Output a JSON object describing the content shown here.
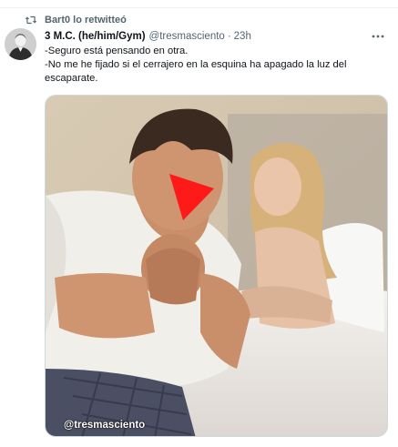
{
  "social_context": {
    "label": "Bart0 lo retwitteó",
    "icon": "retweet-icon"
  },
  "tweet": {
    "author": {
      "display_name": "3 M.C. (he/him/Gym)",
      "handle": "@tresmasciento",
      "avatar_icon": "avatar-photo"
    },
    "separator": "·",
    "time": "23h",
    "more_icon": "more-icon",
    "text_lines": [
      "-Seguro está pensando en otra.",
      "-No me he fijado si el cerrajero en la esquina ha apagado la luz del escaparate."
    ],
    "media": {
      "watermark": "@tresmasciento",
      "overlay_icon": "red-triangle-icon"
    }
  },
  "colors": {
    "text_primary": "#0f1419",
    "text_secondary": "#536471",
    "border": "#cfd9de",
    "overlay_red": "#ff1a1a"
  }
}
